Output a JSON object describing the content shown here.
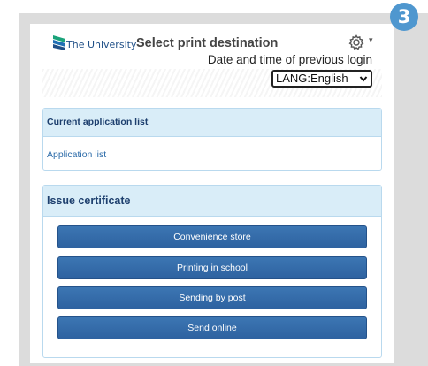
{
  "step_badge": "3",
  "header": {
    "university_name": "The University",
    "title": "Select print destination",
    "login_info": "Date and time of previous login",
    "language_select": "LANG:English",
    "icons": {
      "logo": "university-logo",
      "settings": "gear-icon",
      "dropdown": "chevron-down-icon"
    }
  },
  "current_application": {
    "heading": "Current application list",
    "link": "Application list"
  },
  "issue_certificate": {
    "heading": "Issue certificate",
    "buttons": [
      "Convenience store",
      "Printing in school",
      "Sending by post",
      "Send online"
    ]
  },
  "colors": {
    "button": "#2e62a0",
    "card_header": "#d9edf8",
    "badge": "#4f97cf"
  }
}
